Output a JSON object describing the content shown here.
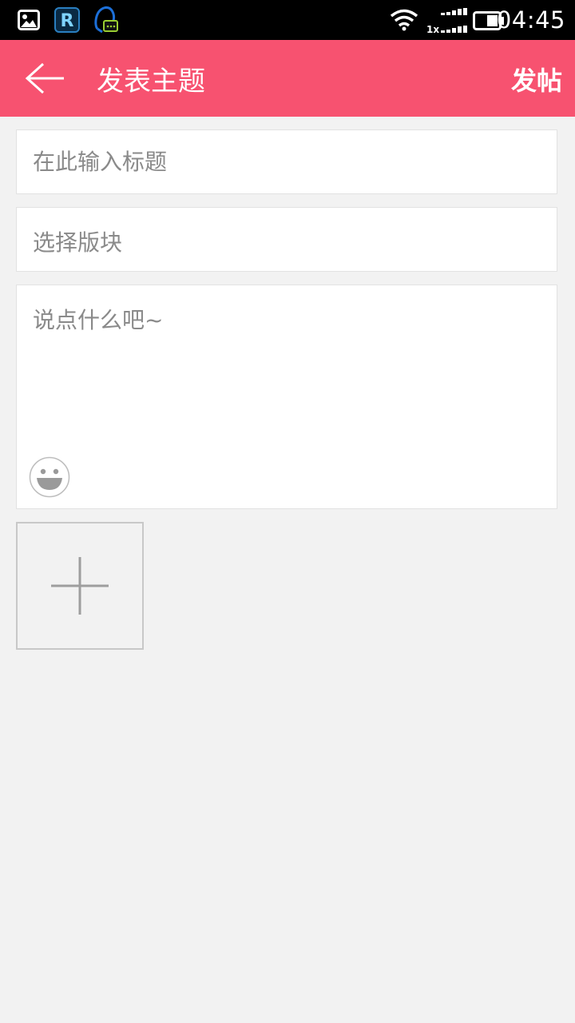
{
  "status_bar": {
    "icons": [
      "gallery-icon",
      "r-app-icon",
      "qq-message-icon"
    ],
    "wifi": "wifi-icon",
    "signal": "signal-icon",
    "network_label": "1x",
    "battery": "battery-icon",
    "time": "04:45"
  },
  "header": {
    "back_icon": "back-arrow-icon",
    "title": "发表主题",
    "post_label": "发帖",
    "color": "#f75270"
  },
  "form": {
    "title_placeholder": "在此输入标题",
    "section_label": "选择版块",
    "content_placeholder": "说点什么吧~",
    "emoji_icon": "emoji-smile-icon",
    "add_image_icon": "plus-icon"
  }
}
